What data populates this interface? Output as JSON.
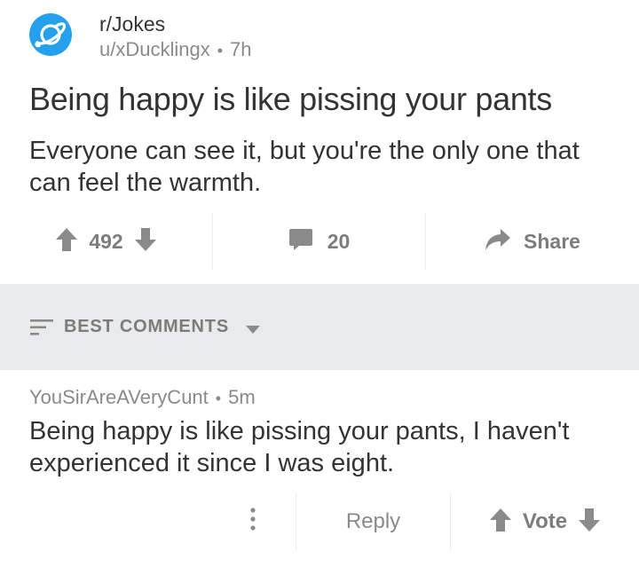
{
  "post": {
    "subreddit": "r/Jokes",
    "author": "u/xDucklingx",
    "separator": "•",
    "age": "7h",
    "title": "Being happy is like pissing your pants",
    "body": "Everyone can see it, but you're the only one that can feel the warmth.",
    "score": "492",
    "comment_count": "20",
    "share_label": "Share"
  },
  "sort": {
    "label": "BEST COMMENTS"
  },
  "comment": {
    "author": "YouSirAreAVeryCunt",
    "separator": "•",
    "age": "5m",
    "body": "Being happy is like pissing your pants, I haven't experienced it since I was eight.",
    "reply_label": "Reply",
    "vote_label": "Vote"
  },
  "colors": {
    "brand": "#24a0ed",
    "text": "#333333",
    "muted": "#8a8a8a",
    "sort_bar_bg": "#e9eaec"
  },
  "icons": [
    "subreddit-planet-icon",
    "upvote-arrow-icon",
    "downvote-arrow-icon",
    "comment-bubble-icon",
    "share-arrow-icon",
    "sort-lines-icon",
    "caret-down-icon",
    "more-dots-icon"
  ]
}
